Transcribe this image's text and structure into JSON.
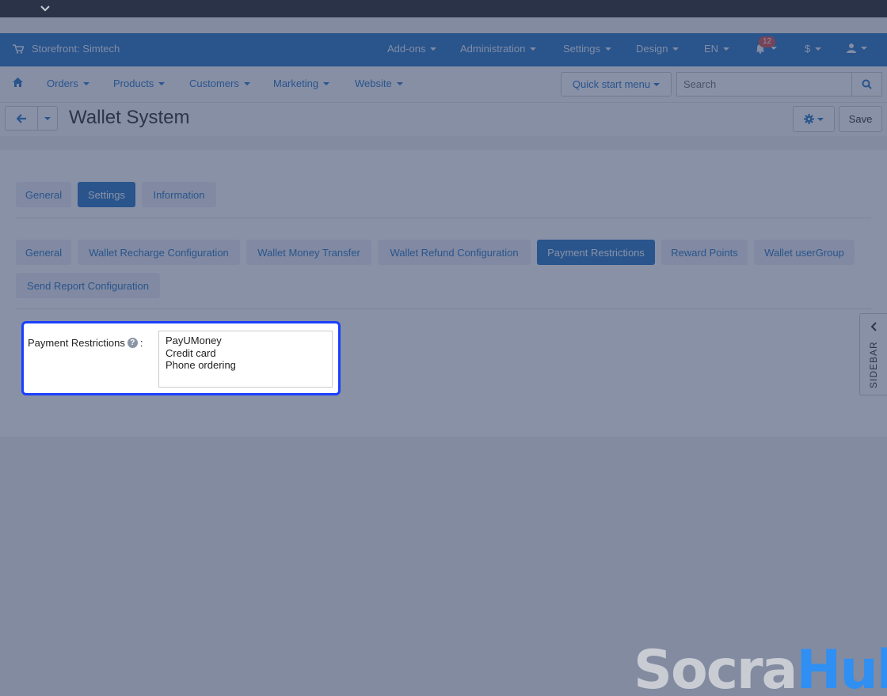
{
  "header": {
    "storefront": "Storefront: Simtech",
    "menus": [
      "Add-ons",
      "Administration",
      "Settings",
      "Design",
      "EN"
    ],
    "notification_count": "12",
    "currency": "$"
  },
  "nav": {
    "items": [
      "Orders",
      "Products",
      "Customers",
      "Marketing",
      "Website"
    ],
    "quick_start": "Quick start menu",
    "search_placeholder": "Search"
  },
  "page": {
    "title": "Wallet System",
    "save_label": "Save"
  },
  "tabs": {
    "top": [
      "General",
      "Settings",
      "Information"
    ],
    "active_top": "Settings",
    "sub": [
      "General",
      "Wallet Recharge Configuration",
      "Wallet Money Transfer",
      "Wallet Refund Configuration",
      "Payment Restrictions",
      "Reward Points",
      "Wallet userGroup",
      "Send Report Configuration"
    ],
    "active_sub": "Payment Restrictions"
  },
  "form": {
    "label": "Payment Restrictions",
    "label_suffix": ":",
    "options": [
      "PayUMoney",
      "Credit card",
      "Phone ordering"
    ]
  },
  "sidebar": {
    "label": "SIDEBAR"
  },
  "watermark": {
    "part1": "Socra",
    "part2": "Hub"
  },
  "colors": {
    "primary": "#2b78c4",
    "topbar": "#2a3347",
    "highlight": "#1a3fff",
    "badge": "#d9534f"
  }
}
